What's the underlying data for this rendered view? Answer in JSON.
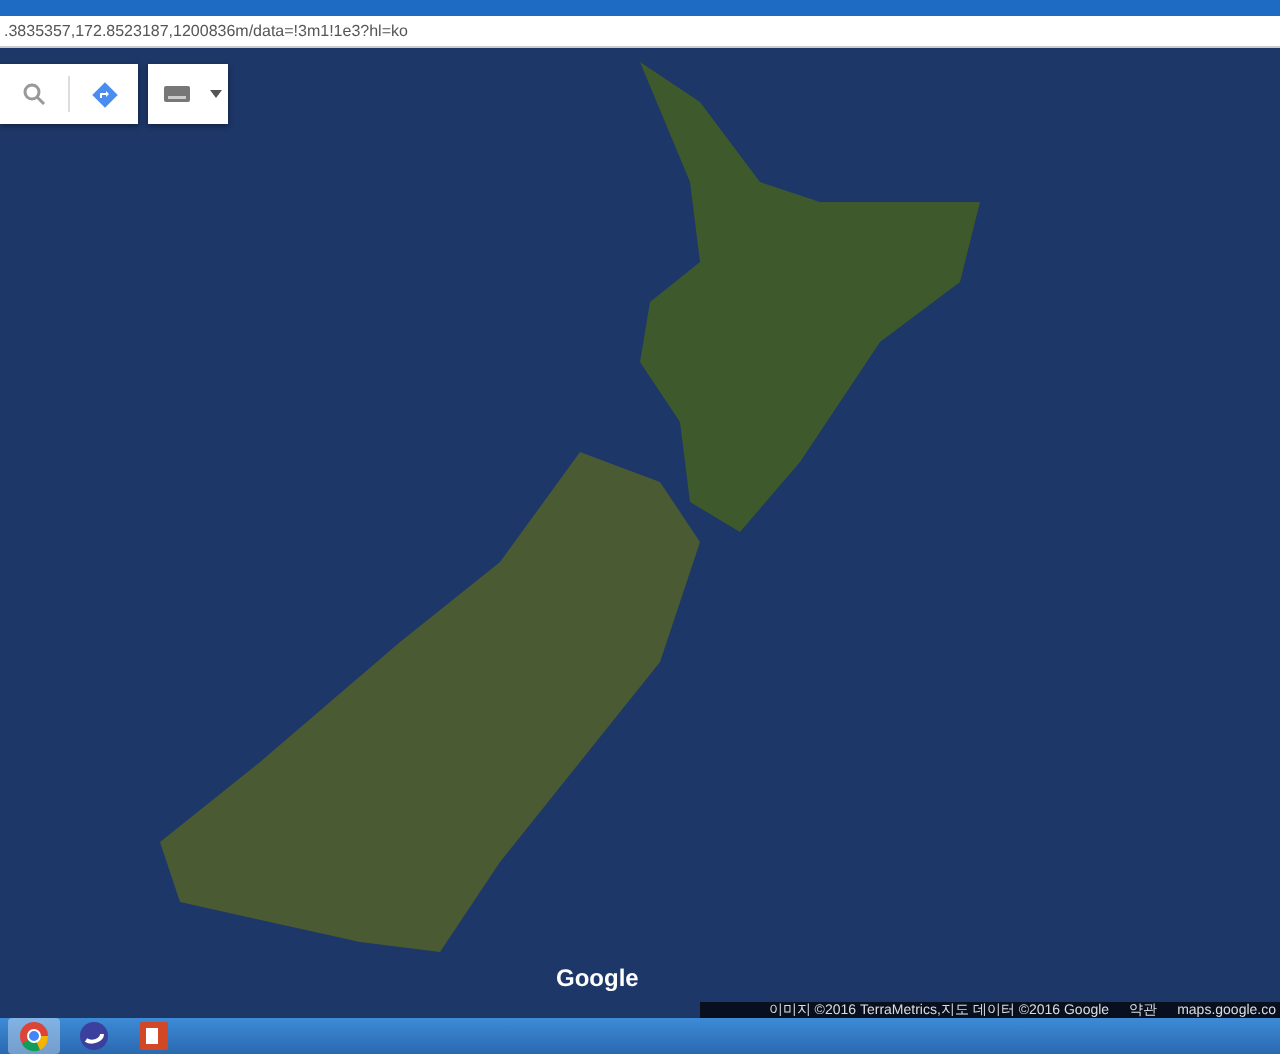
{
  "address_bar": {
    "url": ".3835357,172.8523187,1200836m/data=!3m1!1e3?hl=ko"
  },
  "map": {
    "logo": "Google",
    "attribution": [
      "이미지 ©2016 TerraMetrics,지도 데이터 ©2016 Google",
      "약관",
      "maps.google.co"
    ]
  },
  "taskbar": {
    "apps": [
      {
        "kind": "browser",
        "selected": true
      },
      {
        "kind": "sphere",
        "selected": false
      },
      {
        "kind": "slides",
        "selected": false
      }
    ]
  }
}
